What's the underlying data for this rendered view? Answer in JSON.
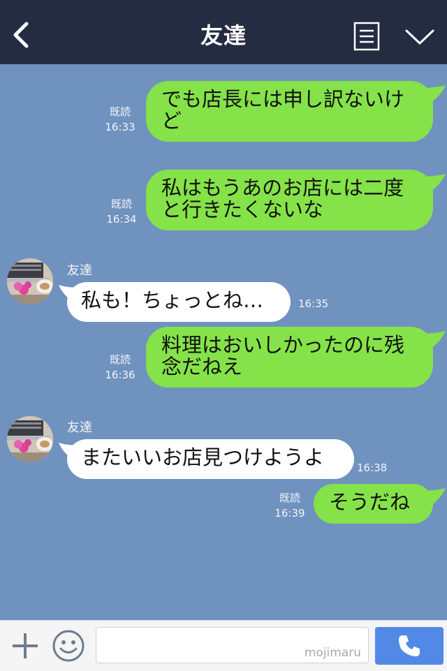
{
  "header": {
    "title": "友達"
  },
  "messages": [
    {
      "direction": "out",
      "text": "でも店長には申し訳ないけど",
      "read_label": "既読",
      "time": "16:33"
    },
    {
      "direction": "out",
      "text": "私はもうあのお店には二度と行きたくないな",
      "read_label": "既読",
      "time": "16:34"
    },
    {
      "direction": "in",
      "sender": "友達",
      "text": "私も！ちょっとね…",
      "time": "16:35"
    },
    {
      "direction": "out",
      "text": "料理はおいしかったのに残念だねえ",
      "read_label": "既読",
      "time": "16:36"
    },
    {
      "direction": "in",
      "sender": "友達",
      "text": "またいいお店見つけようよ",
      "time": "16:38"
    },
    {
      "direction": "out",
      "text": "そうだね",
      "read_label": "既読",
      "time": "16:39"
    }
  ],
  "input": {
    "value": "",
    "watermark": "mojimaru"
  },
  "icons": [
    "back-icon",
    "menu-icon",
    "chevron-down-icon",
    "plus-icon",
    "smile-icon",
    "phone-icon"
  ],
  "colors": {
    "header": "#232c41",
    "background": "#7092bf",
    "outgoing_bubble": "#85e249",
    "incoming_bubble": "#ffffff",
    "call_button": "#5289e6"
  }
}
